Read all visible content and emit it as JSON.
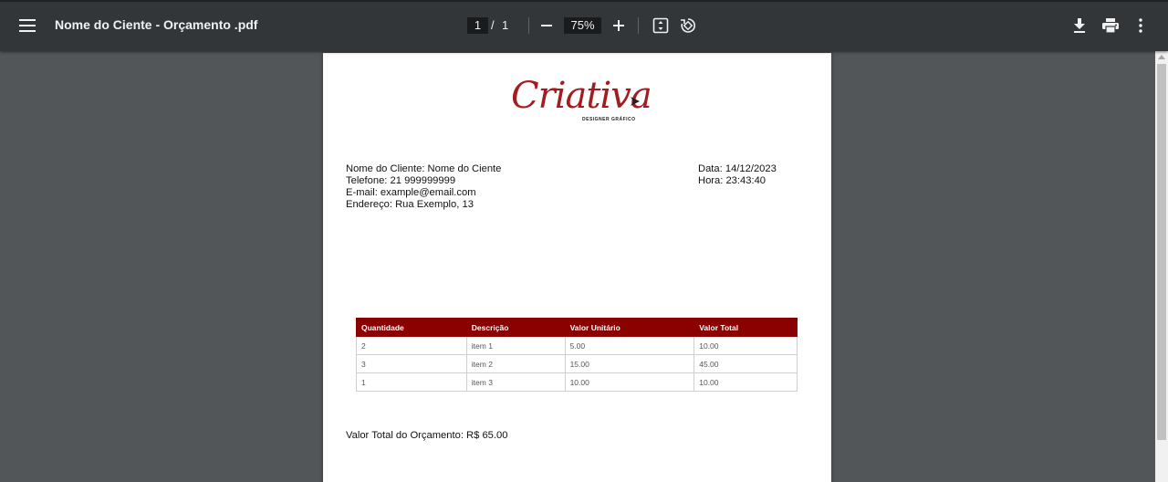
{
  "toolbar": {
    "title": "Nome do Ciente - Orçamento .pdf",
    "page_current": "1",
    "page_separator": "/",
    "page_total": "1",
    "zoom": "75%"
  },
  "icons": {
    "menu": "menu-icon",
    "zoom_out": "minus-icon",
    "zoom_in": "plus-icon",
    "fit": "fit-page-icon",
    "rotate": "rotate-icon",
    "download": "download-icon",
    "print": "print-icon",
    "more": "more-vertical-icon"
  },
  "document": {
    "logo": {
      "text": "Criativa",
      "subtitle": "DESIGNER GRÁFICO"
    },
    "client": {
      "name": "Nome do Cliente: Nome do Ciente",
      "phone": "Telefone: 21 999999999",
      "email": "E-mail: example@email.com",
      "address": "Endereço: Rua Exemplo, 13"
    },
    "date": "Data: 14/12/2023",
    "time": "Hora: 23:43:40",
    "table": {
      "headers": [
        "Quantidade",
        "Descrição",
        "Valor Unitário",
        "Valor Total"
      ],
      "rows": [
        [
          "2",
          "item 1",
          "5.00",
          "10.00"
        ],
        [
          "3",
          "item 2",
          "15.00",
          "45.00"
        ],
        [
          "1",
          "item 3",
          "10.00",
          "10.00"
        ]
      ]
    },
    "total": "Valor Total do Orçamento: R$ 65.00"
  },
  "colors": {
    "toolbar_bg": "#323639",
    "viewer_bg": "#525659",
    "table_header": "#8b0000",
    "logo": "#a21d21"
  }
}
